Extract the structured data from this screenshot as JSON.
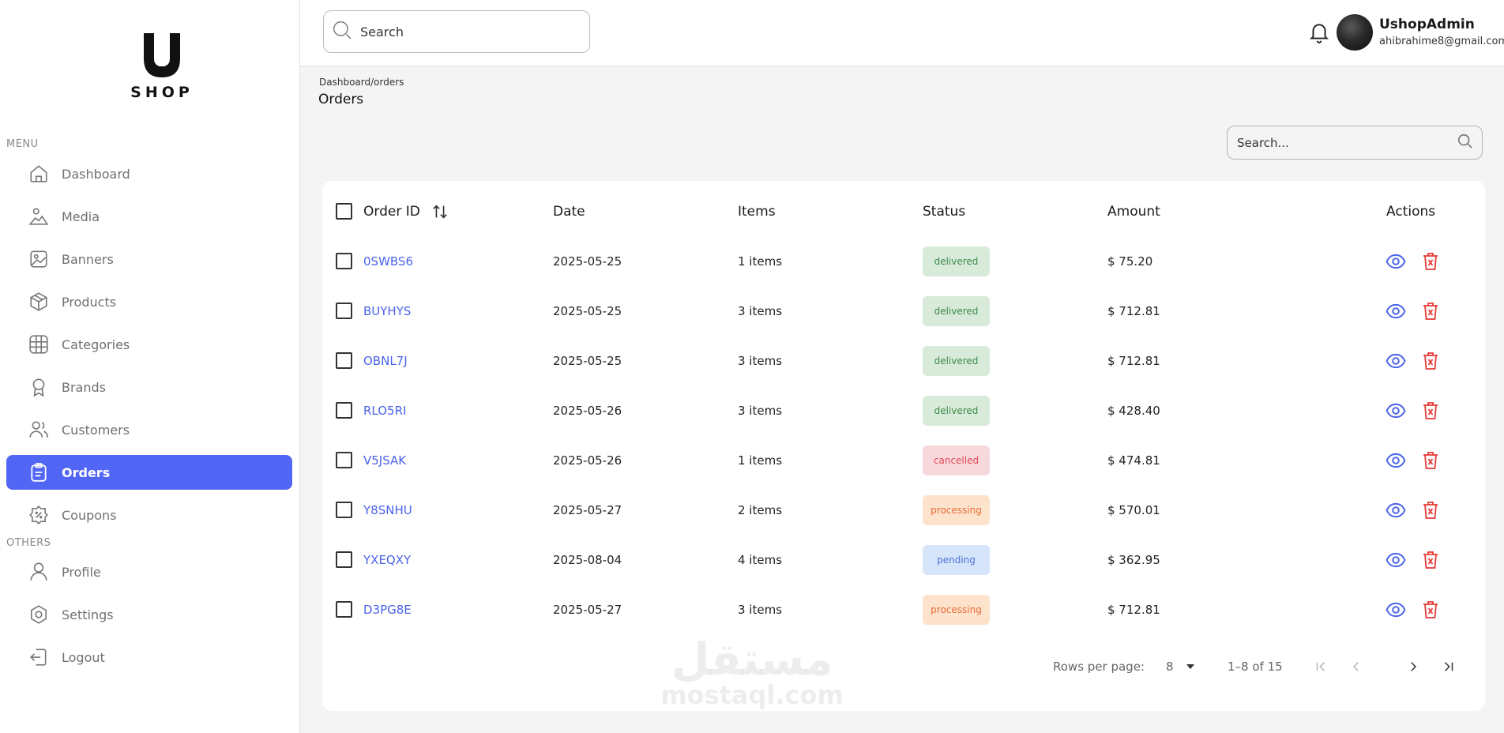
{
  "brand": {
    "logo_letter": "U",
    "logo_text": "SHOP"
  },
  "sidebar": {
    "menu_label": "MENU",
    "others_label": "OTHERS",
    "menu_items": [
      {
        "label": "Dashboard",
        "icon": "home-icon",
        "active": false
      },
      {
        "label": "Media",
        "icon": "image-icon",
        "active": false
      },
      {
        "label": "Banners",
        "icon": "banner-icon",
        "active": false
      },
      {
        "label": "Products",
        "icon": "box-icon",
        "active": false
      },
      {
        "label": "Categories",
        "icon": "grid-icon",
        "active": false
      },
      {
        "label": "Brands",
        "icon": "award-icon",
        "active": false
      },
      {
        "label": "Customers",
        "icon": "users-icon",
        "active": false
      },
      {
        "label": "Orders",
        "icon": "clipboard-icon",
        "active": true
      },
      {
        "label": "Coupons",
        "icon": "discount-icon",
        "active": false
      }
    ],
    "other_items": [
      {
        "label": "Profile",
        "icon": "user-icon"
      },
      {
        "label": "Settings",
        "icon": "gear-icon"
      },
      {
        "label": "Logout",
        "icon": "logout-icon"
      }
    ]
  },
  "topbar": {
    "search_placeholder": "Search",
    "user_name": "UshopAdmin",
    "user_email": "ahibrahime8@gmail.com"
  },
  "page": {
    "breadcrumb": "Dashboard/orders",
    "title": "Orders",
    "table_search_placeholder": "Search..."
  },
  "table": {
    "columns": [
      "Order ID",
      "Date",
      "Items",
      "Status",
      "Amount",
      "Actions"
    ],
    "rows": [
      {
        "id": "0SWBS6",
        "date": "2025-05-25",
        "items": "1 items",
        "status": "delivered",
        "amount": "$ 75.20"
      },
      {
        "id": "BUYHYS",
        "date": "2025-05-25",
        "items": "3 items",
        "status": "delivered",
        "amount": "$ 712.81"
      },
      {
        "id": "OBNL7J",
        "date": "2025-05-25",
        "items": "3 items",
        "status": "delivered",
        "amount": "$ 712.81"
      },
      {
        "id": "RLO5RI",
        "date": "2025-05-26",
        "items": "3 items",
        "status": "delivered",
        "amount": "$ 428.40"
      },
      {
        "id": "V5JSAK",
        "date": "2025-05-26",
        "items": "1 items",
        "status": "cancelled",
        "amount": "$ 474.81"
      },
      {
        "id": "Y8SNHU",
        "date": "2025-05-27",
        "items": "2 items",
        "status": "processing",
        "amount": "$ 570.01"
      },
      {
        "id": "YXEQXY",
        "date": "2025-08-04",
        "items": "4 items",
        "status": "pending",
        "amount": "$ 362.95"
      },
      {
        "id": "D3PG8E",
        "date": "2025-05-27",
        "items": "3 items",
        "status": "processing",
        "amount": "$ 712.81"
      }
    ]
  },
  "pagination": {
    "rows_per_page_label": "Rows per page:",
    "rows_per_page_value": "8",
    "range": "1–8 of 15"
  },
  "watermark": {
    "arabic": "مستقل",
    "latin": "mostaql.com"
  },
  "colors": {
    "accent": "#5166f4",
    "link": "#4a63e8",
    "danger": "#e53935"
  }
}
